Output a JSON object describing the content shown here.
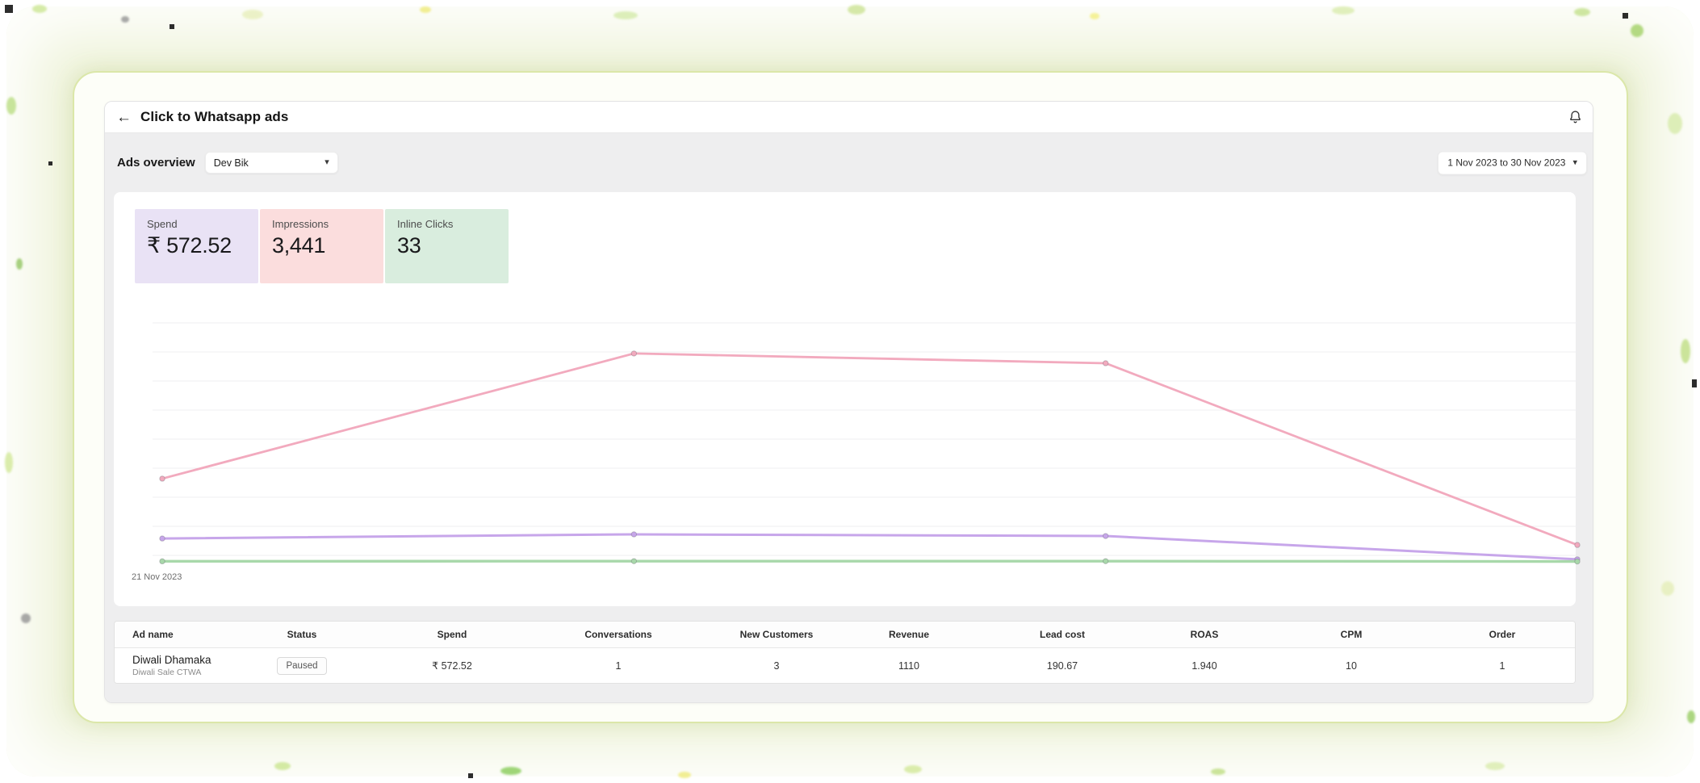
{
  "header": {
    "title": "Click to Whatsapp ads"
  },
  "toolbar": {
    "section_title": "Ads overview",
    "account_selector": {
      "value": "Dev Bik",
      "caret": "▾"
    },
    "date_range_selector": {
      "value": "1 Nov 2023 to 30 Nov 2023",
      "caret": "▾"
    }
  },
  "stat_cards": [
    {
      "label": "Spend",
      "value": "₹ 572.52",
      "bg_color": "#e9e2f5"
    },
    {
      "label": "Impressions",
      "value": "3,441",
      "bg_color": "#fbdddd"
    },
    {
      "label": "Inline Clicks",
      "value": "33",
      "bg_color": "#d9edde"
    }
  ],
  "chart_data": {
    "type": "line",
    "categories": [
      "21 Nov 2023",
      "",
      "",
      ""
    ],
    "x_axis_visible_label": "21 Nov 2023",
    "series": [
      {
        "name": "Impressions",
        "color": "#f2aabe",
        "stroke_width": 2.8,
        "values": [
          508,
          1265,
          1206,
          107
        ]
      },
      {
        "name": "Spend",
        "color": "#c7a6ea",
        "stroke_width": 3,
        "values": [
          146,
          171,
          161,
          20
        ]
      },
      {
        "name": "Inline Clicks",
        "color": "#a8d8aa",
        "stroke_width": 3.4,
        "values": [
          8,
          9,
          9,
          7
        ]
      }
    ],
    "ylim": [
      0,
      1450
    ],
    "grid": true,
    "gridline_color": "#efeff0",
    "legend": "none",
    "title": "",
    "xlabel": "",
    "ylabel": ""
  },
  "table": {
    "columns": [
      {
        "label": "Ad name"
      },
      {
        "label": "Status"
      },
      {
        "label": "Spend"
      },
      {
        "label": "Conversations"
      },
      {
        "label": "New Customers"
      },
      {
        "label": "Revenue"
      },
      {
        "label": "Lead cost"
      },
      {
        "label": "ROAS"
      },
      {
        "label": "CPM"
      },
      {
        "label": "Order"
      }
    ],
    "rows": [
      {
        "ad_name": "Diwali Dhamaka",
        "ad_subtitle": "Diwali Sale CTWA",
        "status": "Paused",
        "spend": "₹ 572.52",
        "conversations": "1",
        "new_customers": "3",
        "revenue": "1110",
        "lead_cost": "190.67",
        "roas": "1.940",
        "cpm": "10",
        "order": "1"
      }
    ]
  }
}
